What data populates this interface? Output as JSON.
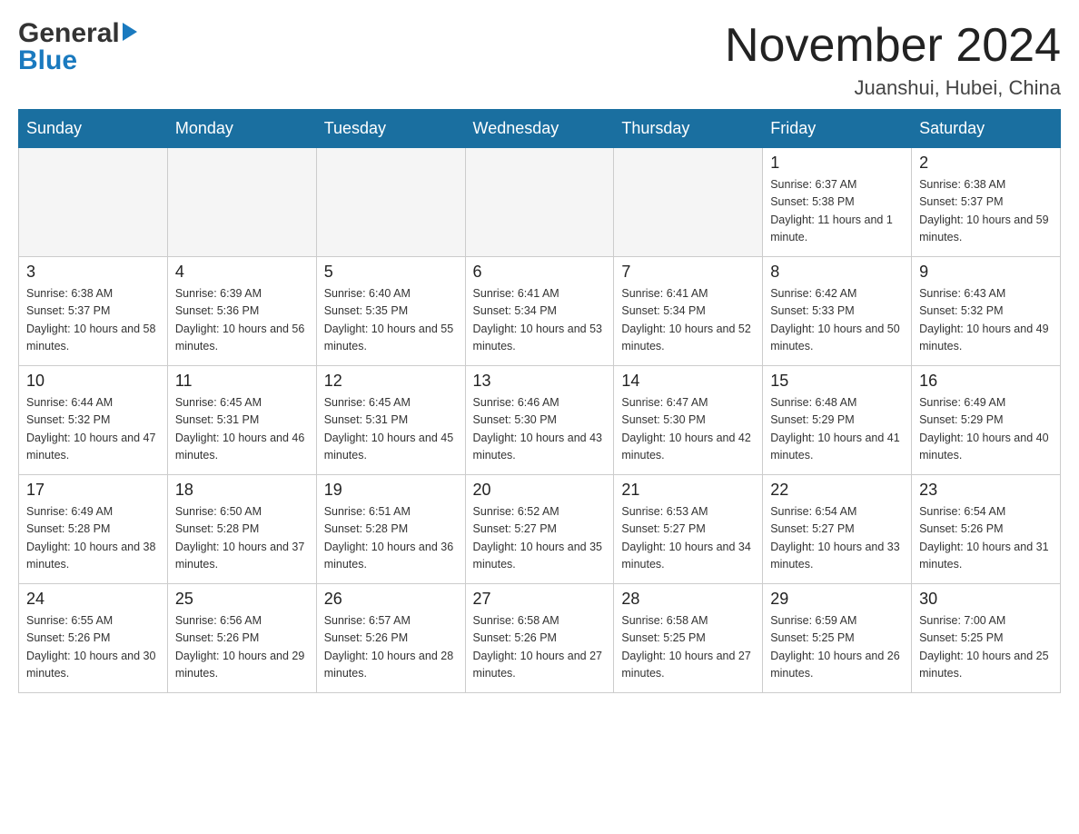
{
  "header": {
    "month_year": "November 2024",
    "location": "Juanshui, Hubei, China",
    "logo_general": "General",
    "logo_blue": "Blue"
  },
  "weekdays": [
    "Sunday",
    "Monday",
    "Tuesday",
    "Wednesday",
    "Thursday",
    "Friday",
    "Saturday"
  ],
  "weeks": [
    [
      {
        "day": "",
        "sunrise": "",
        "sunset": "",
        "daylight": ""
      },
      {
        "day": "",
        "sunrise": "",
        "sunset": "",
        "daylight": ""
      },
      {
        "day": "",
        "sunrise": "",
        "sunset": "",
        "daylight": ""
      },
      {
        "day": "",
        "sunrise": "",
        "sunset": "",
        "daylight": ""
      },
      {
        "day": "",
        "sunrise": "",
        "sunset": "",
        "daylight": ""
      },
      {
        "day": "1",
        "sunrise": "Sunrise: 6:37 AM",
        "sunset": "Sunset: 5:38 PM",
        "daylight": "Daylight: 11 hours and 1 minute."
      },
      {
        "day": "2",
        "sunrise": "Sunrise: 6:38 AM",
        "sunset": "Sunset: 5:37 PM",
        "daylight": "Daylight: 10 hours and 59 minutes."
      }
    ],
    [
      {
        "day": "3",
        "sunrise": "Sunrise: 6:38 AM",
        "sunset": "Sunset: 5:37 PM",
        "daylight": "Daylight: 10 hours and 58 minutes."
      },
      {
        "day": "4",
        "sunrise": "Sunrise: 6:39 AM",
        "sunset": "Sunset: 5:36 PM",
        "daylight": "Daylight: 10 hours and 56 minutes."
      },
      {
        "day": "5",
        "sunrise": "Sunrise: 6:40 AM",
        "sunset": "Sunset: 5:35 PM",
        "daylight": "Daylight: 10 hours and 55 minutes."
      },
      {
        "day": "6",
        "sunrise": "Sunrise: 6:41 AM",
        "sunset": "Sunset: 5:34 PM",
        "daylight": "Daylight: 10 hours and 53 minutes."
      },
      {
        "day": "7",
        "sunrise": "Sunrise: 6:41 AM",
        "sunset": "Sunset: 5:34 PM",
        "daylight": "Daylight: 10 hours and 52 minutes."
      },
      {
        "day": "8",
        "sunrise": "Sunrise: 6:42 AM",
        "sunset": "Sunset: 5:33 PM",
        "daylight": "Daylight: 10 hours and 50 minutes."
      },
      {
        "day": "9",
        "sunrise": "Sunrise: 6:43 AM",
        "sunset": "Sunset: 5:32 PM",
        "daylight": "Daylight: 10 hours and 49 minutes."
      }
    ],
    [
      {
        "day": "10",
        "sunrise": "Sunrise: 6:44 AM",
        "sunset": "Sunset: 5:32 PM",
        "daylight": "Daylight: 10 hours and 47 minutes."
      },
      {
        "day": "11",
        "sunrise": "Sunrise: 6:45 AM",
        "sunset": "Sunset: 5:31 PM",
        "daylight": "Daylight: 10 hours and 46 minutes."
      },
      {
        "day": "12",
        "sunrise": "Sunrise: 6:45 AM",
        "sunset": "Sunset: 5:31 PM",
        "daylight": "Daylight: 10 hours and 45 minutes."
      },
      {
        "day": "13",
        "sunrise": "Sunrise: 6:46 AM",
        "sunset": "Sunset: 5:30 PM",
        "daylight": "Daylight: 10 hours and 43 minutes."
      },
      {
        "day": "14",
        "sunrise": "Sunrise: 6:47 AM",
        "sunset": "Sunset: 5:30 PM",
        "daylight": "Daylight: 10 hours and 42 minutes."
      },
      {
        "day": "15",
        "sunrise": "Sunrise: 6:48 AM",
        "sunset": "Sunset: 5:29 PM",
        "daylight": "Daylight: 10 hours and 41 minutes."
      },
      {
        "day": "16",
        "sunrise": "Sunrise: 6:49 AM",
        "sunset": "Sunset: 5:29 PM",
        "daylight": "Daylight: 10 hours and 40 minutes."
      }
    ],
    [
      {
        "day": "17",
        "sunrise": "Sunrise: 6:49 AM",
        "sunset": "Sunset: 5:28 PM",
        "daylight": "Daylight: 10 hours and 38 minutes."
      },
      {
        "day": "18",
        "sunrise": "Sunrise: 6:50 AM",
        "sunset": "Sunset: 5:28 PM",
        "daylight": "Daylight: 10 hours and 37 minutes."
      },
      {
        "day": "19",
        "sunrise": "Sunrise: 6:51 AM",
        "sunset": "Sunset: 5:28 PM",
        "daylight": "Daylight: 10 hours and 36 minutes."
      },
      {
        "day": "20",
        "sunrise": "Sunrise: 6:52 AM",
        "sunset": "Sunset: 5:27 PM",
        "daylight": "Daylight: 10 hours and 35 minutes."
      },
      {
        "day": "21",
        "sunrise": "Sunrise: 6:53 AM",
        "sunset": "Sunset: 5:27 PM",
        "daylight": "Daylight: 10 hours and 34 minutes."
      },
      {
        "day": "22",
        "sunrise": "Sunrise: 6:54 AM",
        "sunset": "Sunset: 5:27 PM",
        "daylight": "Daylight: 10 hours and 33 minutes."
      },
      {
        "day": "23",
        "sunrise": "Sunrise: 6:54 AM",
        "sunset": "Sunset: 5:26 PM",
        "daylight": "Daylight: 10 hours and 31 minutes."
      }
    ],
    [
      {
        "day": "24",
        "sunrise": "Sunrise: 6:55 AM",
        "sunset": "Sunset: 5:26 PM",
        "daylight": "Daylight: 10 hours and 30 minutes."
      },
      {
        "day": "25",
        "sunrise": "Sunrise: 6:56 AM",
        "sunset": "Sunset: 5:26 PM",
        "daylight": "Daylight: 10 hours and 29 minutes."
      },
      {
        "day": "26",
        "sunrise": "Sunrise: 6:57 AM",
        "sunset": "Sunset: 5:26 PM",
        "daylight": "Daylight: 10 hours and 28 minutes."
      },
      {
        "day": "27",
        "sunrise": "Sunrise: 6:58 AM",
        "sunset": "Sunset: 5:26 PM",
        "daylight": "Daylight: 10 hours and 27 minutes."
      },
      {
        "day": "28",
        "sunrise": "Sunrise: 6:58 AM",
        "sunset": "Sunset: 5:25 PM",
        "daylight": "Daylight: 10 hours and 27 minutes."
      },
      {
        "day": "29",
        "sunrise": "Sunrise: 6:59 AM",
        "sunset": "Sunset: 5:25 PM",
        "daylight": "Daylight: 10 hours and 26 minutes."
      },
      {
        "day": "30",
        "sunrise": "Sunrise: 7:00 AM",
        "sunset": "Sunset: 5:25 PM",
        "daylight": "Daylight: 10 hours and 25 minutes."
      }
    ]
  ]
}
